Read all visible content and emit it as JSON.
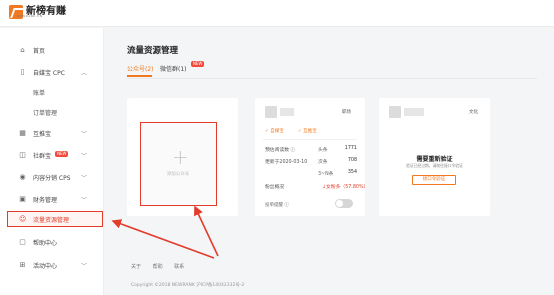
{
  "logo": {
    "text": "新榜有赚",
    "sub": "NEWRANK.CN"
  },
  "sidebar": {
    "items": [
      {
        "label": "首页",
        "icon": "home-icon"
      },
      {
        "label": "自媒宝 CPC",
        "icon": "phone-icon"
      },
      {
        "label": "账单"
      },
      {
        "label": "订单管理"
      },
      {
        "label": "互推宝",
        "icon": "calendar-icon"
      },
      {
        "label": "社群宝",
        "icon": "chat-icon",
        "badge": "NEW"
      },
      {
        "label": "内容分销 CPS",
        "icon": "bag-icon"
      },
      {
        "label": "财务管理",
        "icon": "wallet-icon"
      },
      {
        "label": "流量资源管理",
        "icon": "user-icon"
      },
      {
        "label": "帮助中心",
        "icon": "help-icon"
      },
      {
        "label": "活动中心",
        "icon": "gift-icon"
      }
    ]
  },
  "main": {
    "title": "流量资源管理",
    "tabs": [
      {
        "label": "公众号(2)"
      },
      {
        "label": "微信群(1)",
        "badge": "NEW"
      }
    ],
    "add_card": {
      "label": "添加公众号"
    },
    "account_card": {
      "category": "职场",
      "tags": [
        "自媒宝",
        "互推宝"
      ],
      "rows": [
        {
          "a": "预估阅读数 ⓘ",
          "b": "头条",
          "c": "1771"
        },
        {
          "a": "更新于2020-03-10",
          "b": "次条",
          "c": "708"
        },
        {
          "a": "",
          "b": "3~N条",
          "c": "354"
        }
      ],
      "fans_label": "粉丝概况",
      "fans_trend": "↓女粉多（57.80%）",
      "toggle_label": "投单提醒 ⓘ"
    },
    "verify_card": {
      "category": "文化",
      "title": "需要重新验证",
      "desc": "验证已经过期，请前往接口令验证",
      "button": "接口令验证"
    }
  },
  "footer": {
    "links": [
      "关于",
      "帮助",
      "联系"
    ],
    "copyright": "Copyright ©2018 NEWRANK 沪ICP备14042332号-2"
  },
  "colors": {
    "accent": "#f2791f",
    "highlight": "#e23c2a"
  }
}
